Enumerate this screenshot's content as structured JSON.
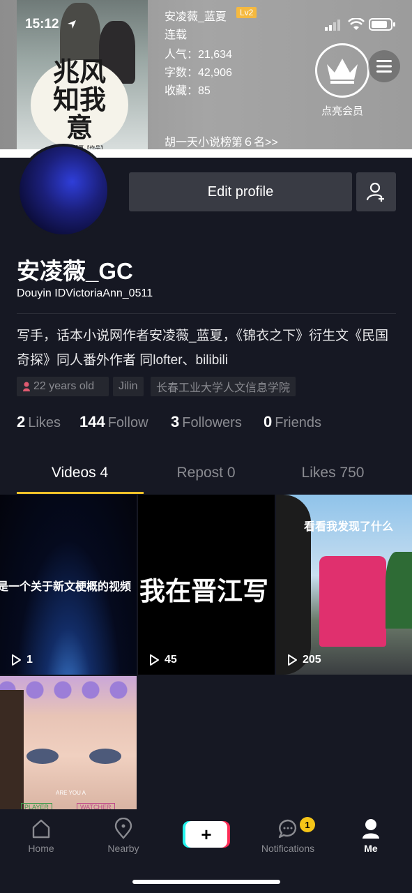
{
  "status_bar": {
    "time": "15:12"
  },
  "banner": {
    "cover_title": "兆风知我意",
    "cover_subtitle": "安凌薇_蓝夏【作品】",
    "author": "安凌薇_蓝夏",
    "level": "Lv2",
    "status": "连载",
    "popularity": "人气：21,634",
    "word_count": "字数：42,906",
    "favorites": "收藏：85",
    "rank_link": "胡一天小说榜第６名>>",
    "vip_label": "点亮会员"
  },
  "profile": {
    "edit_label": "Edit profile",
    "nickname": "安凌薇_GC",
    "douyin_id": "Douyin IDVictoriaAnn_0511",
    "bio": "写手，话本小说网作者安凌薇_蓝夏，《锦衣之下》衍生文《民国奇探》同人番外作者  同lofter、bilibili",
    "tags": [
      "22 years old",
      "Jilin",
      "长春工业大学人文信息学院"
    ],
    "stats": [
      {
        "value": "2",
        "label": "Likes"
      },
      {
        "value": "144",
        "label": "Follow"
      },
      {
        "value": "3",
        "label": "Followers"
      },
      {
        "value": "0",
        "label": "Friends"
      }
    ]
  },
  "tabs": [
    "Videos 4",
    "Repost 0",
    "Likes 750"
  ],
  "videos": [
    {
      "caption": "这是一个关于新文梗概的视频",
      "plays": "1"
    },
    {
      "caption": "我在晋江写",
      "plays": "45"
    },
    {
      "caption": "看看我发现了什么",
      "plays": "205"
    },
    {
      "caption": "ARE YOU A",
      "plays": ""
    }
  ],
  "video4_labels": [
    "PLAYER",
    "WATCHER"
  ],
  "nav": {
    "home": "Home",
    "nearby": "Nearby",
    "create": "+",
    "notifications": "Notifications",
    "notification_count": "1",
    "me": "Me"
  }
}
